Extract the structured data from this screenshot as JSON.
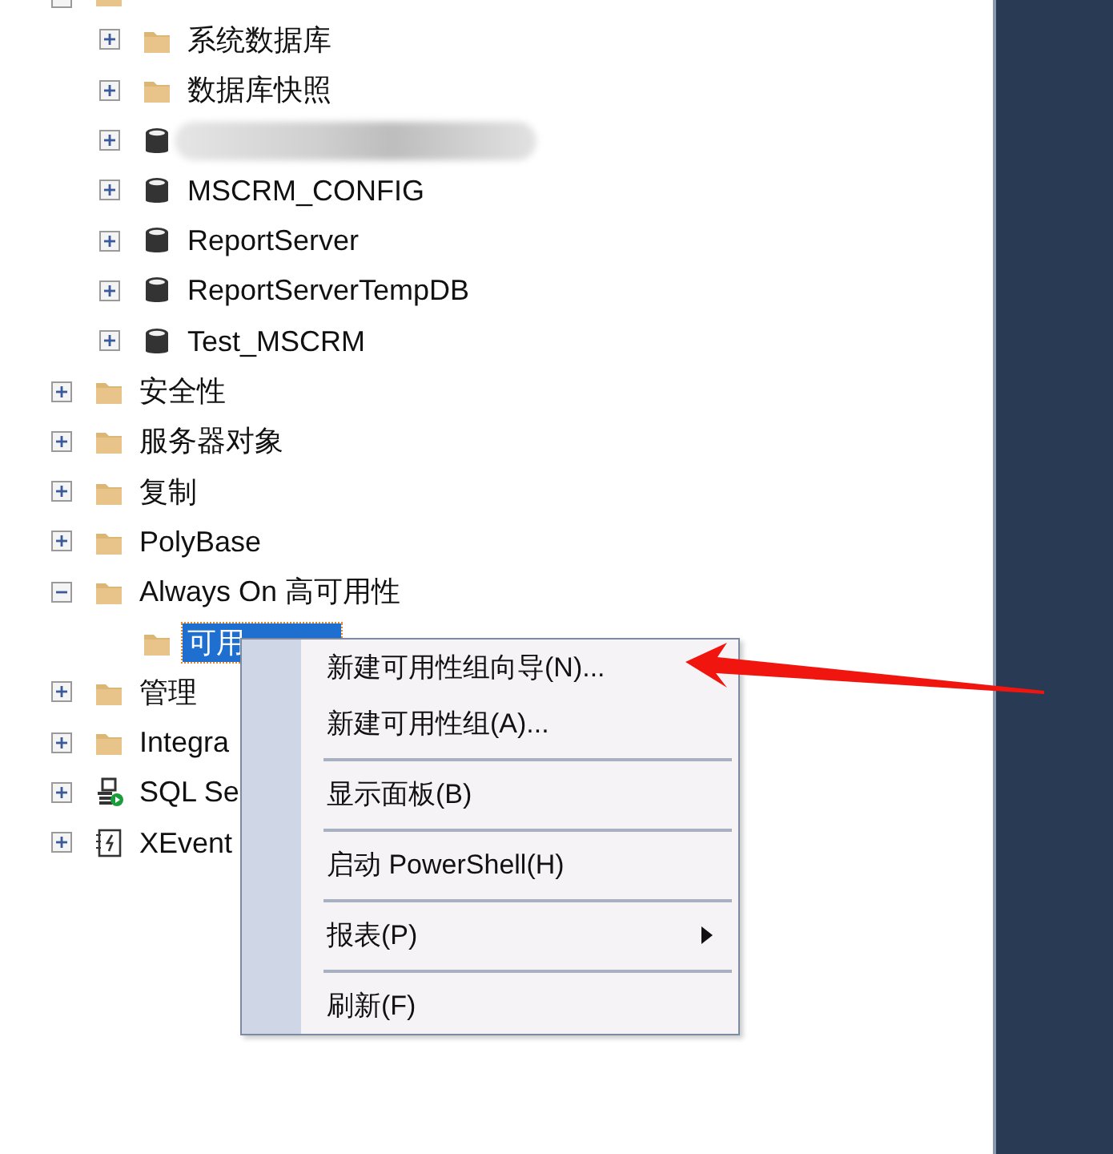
{
  "object_explorer": {
    "items": [
      {
        "kind": "folder",
        "expanded": true,
        "selected": false,
        "children": [
          {
            "kind": "folder",
            "label": "系统数据库",
            "expanded": false,
            "selected": false
          },
          {
            "kind": "folder",
            "label": "数据库快照",
            "expanded": false,
            "selected": false
          },
          {
            "kind": "redacted_database",
            "expanded": false,
            "selected": false
          },
          {
            "kind": "database",
            "label": "MSCRM_CONFIG",
            "expanded": false,
            "selected": false
          },
          {
            "kind": "database",
            "label": "ReportServer",
            "expanded": false,
            "selected": false
          },
          {
            "kind": "database",
            "label": "ReportServerTempDB",
            "expanded": false,
            "selected": false
          },
          {
            "kind": "database",
            "label": "Test_MSCRM",
            "expanded": false,
            "selected": false
          }
        ]
      },
      {
        "kind": "folder",
        "label": "安全性",
        "expanded": false,
        "selected": false
      },
      {
        "kind": "folder",
        "label": "服务器对象",
        "expanded": false,
        "selected": false
      },
      {
        "kind": "folder",
        "label": "复制",
        "expanded": false,
        "selected": false
      },
      {
        "kind": "folder",
        "label": "PolyBase",
        "expanded": false,
        "selected": false
      },
      {
        "kind": "folder",
        "label": "Always On 高可用性",
        "expanded": true,
        "selected": false,
        "children": [
          {
            "kind": "folder",
            "label": "可用",
            "selected": true
          }
        ]
      },
      {
        "kind": "folder",
        "label": "管理",
        "expanded": false,
        "selected": false
      },
      {
        "kind": "folder",
        "label": "Integra",
        "expanded": false,
        "selected": false
      },
      {
        "kind": "agent",
        "label": "SQL Se",
        "expanded": false,
        "selected": false
      },
      {
        "kind": "xevent",
        "label": "XEvent",
        "expanded": false,
        "selected": false
      }
    ]
  },
  "context_menu": {
    "items": [
      {
        "kind": "item",
        "label": "新建可用性组向导(N)..."
      },
      {
        "kind": "item",
        "label": "新建可用性组(A)..."
      },
      {
        "kind": "separator"
      },
      {
        "kind": "item",
        "label": "显示面板(B)"
      },
      {
        "kind": "separator"
      },
      {
        "kind": "item",
        "label": "启动 PowerShell(H)"
      },
      {
        "kind": "separator"
      },
      {
        "kind": "submenu",
        "label": "报表(P)"
      },
      {
        "kind": "separator"
      },
      {
        "kind": "item",
        "label": "刷新(F)"
      }
    ]
  },
  "annotation": {
    "kind": "arrow"
  }
}
